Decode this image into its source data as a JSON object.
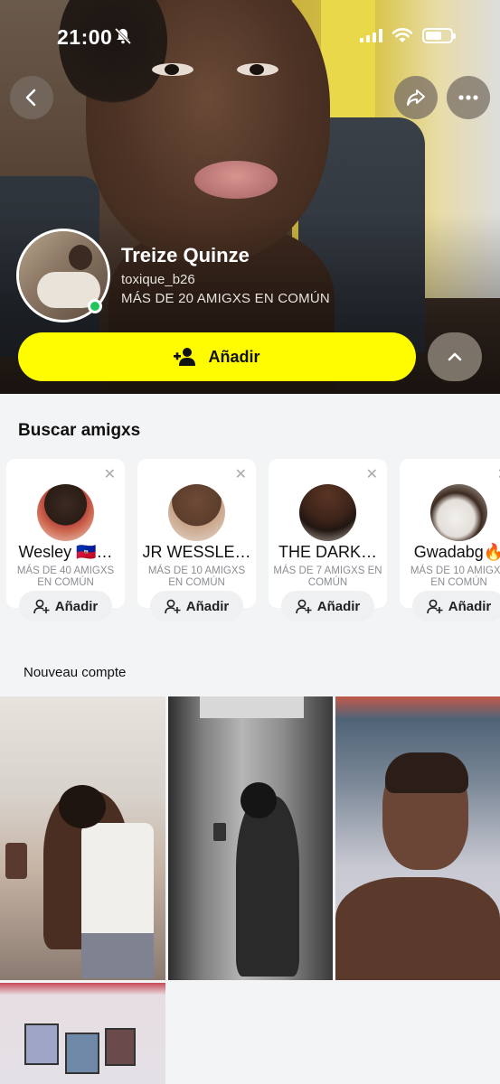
{
  "status_bar": {
    "time": "21:00",
    "battery_level": 0.65
  },
  "profile": {
    "name": "Treize Quinze",
    "username": "toxique_b26",
    "mutual": "MÁS DE 20 AMIGXS EN COMÚN",
    "online": true,
    "add_label": "Añadir"
  },
  "find_friends": {
    "title": "Buscar amigxs",
    "cards": [
      {
        "name": "Wesley 🇭🇹…",
        "mutual": "MÁS DE 40 AMIGXS EN COMÚN",
        "add_label": "Añadir"
      },
      {
        "name": "JR WESSLE…",
        "mutual": "MÁS DE 10 AMIGXS EN COMÚN",
        "add_label": "Añadir"
      },
      {
        "name": "THE DARK…",
        "mutual": "MÁS DE 7 AMIGXS EN COMÚN",
        "add_label": "Añadir"
      },
      {
        "name": "Gwadabg🔥",
        "mutual": "MÁS DE 10 AMIGXS EN COMÚN",
        "add_label": "Añadir"
      }
    ]
  },
  "new_account": {
    "title": "Nouveau compte"
  },
  "colors": {
    "accent": "#fffc00",
    "online": "#25c35b"
  }
}
